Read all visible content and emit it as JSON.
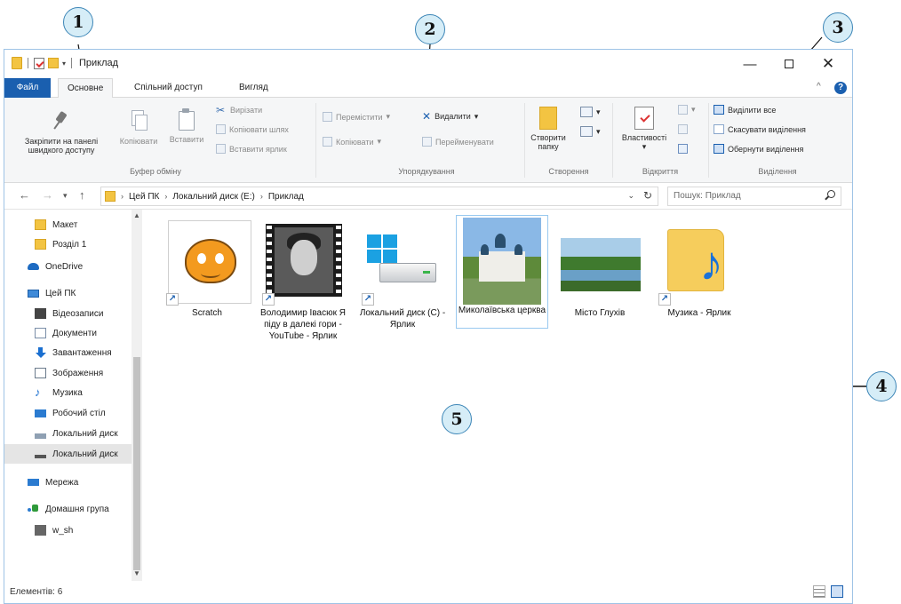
{
  "window": {
    "title": "Приклад",
    "controls": {
      "minimize": "—",
      "maximize": "",
      "close": "✕"
    }
  },
  "tabs": [
    "Файл",
    "Основне",
    "Спільний доступ",
    "Вигляд"
  ],
  "ribbon": {
    "clipboard": {
      "pin_line1": "Закріпити на панелі",
      "pin_line2": "швидкого доступу",
      "copy": "Копіювати",
      "paste": "Вставити",
      "cut": "Вирізати",
      "copy_path": "Копіювати шлях",
      "paste_shortcut": "Вставити ярлик",
      "group": "Буфер обміну"
    },
    "organize": {
      "move": "Перемістити",
      "copy_to": "Копіювати",
      "delete": "Видалити",
      "rename": "Перейменувати",
      "group": "Упорядкування"
    },
    "create": {
      "new_folder_line1": "Створити",
      "new_folder_line2": "папку",
      "group": "Створення"
    },
    "open": {
      "properties": "Властивості",
      "group": "Відкриття"
    },
    "select": {
      "select_all": "Виділити все",
      "select_none": "Скасувати виділення",
      "invert": "Обернути виділення",
      "group": "Виділення"
    }
  },
  "address": {
    "crumbs": [
      "Цей ПК",
      "Локальний диск (E:)",
      "Приклад"
    ],
    "search_placeholder": "Пошук: Приклад"
  },
  "nav_pane": {
    "items": [
      {
        "label": "Макет",
        "icon": "folder-icon"
      },
      {
        "label": "Розділ 1",
        "icon": "folder-icon"
      },
      {
        "label": "OneDrive",
        "icon": "cloud-icon"
      },
      {
        "label": "Цей ПК",
        "icon": "computer-icon"
      },
      {
        "label": "Відеозаписи",
        "icon": "video-icon"
      },
      {
        "label": "Документи",
        "icon": "documents-icon"
      },
      {
        "label": "Завантаження",
        "icon": "downloads-icon"
      },
      {
        "label": "Зображення",
        "icon": "pictures-icon"
      },
      {
        "label": "Музика",
        "icon": "music-icon"
      },
      {
        "label": "Робочий стіл",
        "icon": "desktop-icon"
      },
      {
        "label": "Локальний диск",
        "icon": "drive-icon"
      },
      {
        "label": "Локальний диск",
        "icon": "drive-icon"
      },
      {
        "label": "Мережа",
        "icon": "network-icon"
      },
      {
        "label": "Домашня група",
        "icon": "homegroup-icon"
      },
      {
        "label": "w_sh",
        "icon": "user-icon"
      }
    ]
  },
  "files": [
    {
      "label": "Scratch"
    },
    {
      "label": "Володимир Івасюк Я піду в далекі гори - YouTube - Ярлик"
    },
    {
      "label": "Локальний диск (C) - Ярлик"
    },
    {
      "label": "Миколаївська церква"
    },
    {
      "label": "Місто Глухів"
    },
    {
      "label": "Музика - Ярлик"
    }
  ],
  "status": {
    "count": "Елементів: 6"
  },
  "annotations": {
    "n1": "1",
    "n2": "2",
    "n3": "3",
    "n4": "4",
    "n5": "5"
  }
}
